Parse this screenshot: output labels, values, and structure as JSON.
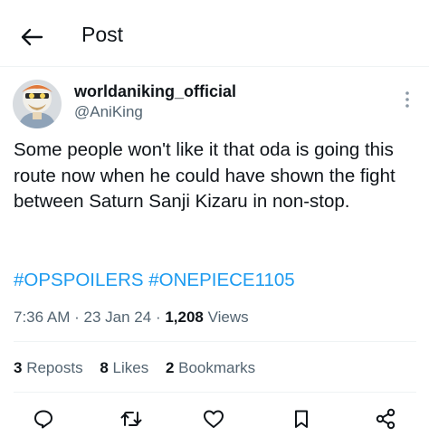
{
  "header": {
    "title": "Post"
  },
  "author": {
    "display_name": "worldaniking_official",
    "handle": "@AniKing"
  },
  "tweet": {
    "text": "Some people won't like it that oda is going this route now when he could have shown the fight between Saturn Sanji Kizaru in non-stop.",
    "hashtags": [
      "#OPSPOILERS",
      "#ONEPIECE1105"
    ]
  },
  "meta": {
    "time": "7:36 AM",
    "date": "23 Jan 24",
    "separator": "·",
    "views_count": "1,208",
    "views_label": "Views"
  },
  "stats": {
    "reposts_count": "3",
    "reposts_label": "Reposts",
    "likes_count": "8",
    "likes_label": "Likes",
    "bookmarks_count": "2",
    "bookmarks_label": "Bookmarks"
  },
  "icons": {
    "back": "arrow-left-icon",
    "more": "vertical-dots-icon",
    "reply": "reply-icon",
    "repost": "repost-icon",
    "like": "heart-icon",
    "bookmark": "bookmark-icon",
    "share": "share-icon"
  },
  "colors": {
    "text": "#0f1419",
    "secondary": "#536471",
    "hashtag": "#1d9bf0",
    "divider": "#eff3f4"
  }
}
